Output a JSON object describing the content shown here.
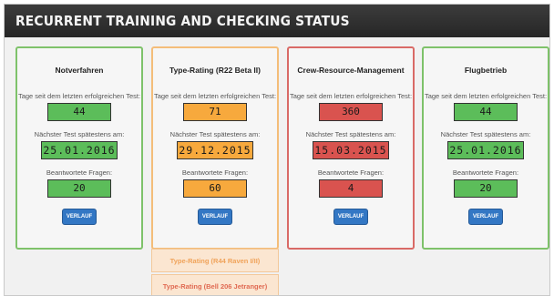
{
  "page": {
    "title": "RECURRENT TRAINING AND CHECKING STATUS"
  },
  "labels": {
    "days_since": "Tage seit dem letzten erfolgreichen Test:",
    "next_test": "Nächster Test spätestens am:",
    "answered": "Beantwortete Fragen:",
    "history_button": "VERLAUF"
  },
  "cards": [
    {
      "title": "Notverfahren",
      "status": "green",
      "days": "44",
      "next_date": "25.01.2016",
      "questions": "20"
    },
    {
      "title": "Type-Rating (R22 Beta II)",
      "status": "orange",
      "days": "71",
      "next_date": "29.12.2015",
      "questions": "60"
    },
    {
      "title": "Crew-Resource-Management",
      "status": "red",
      "days": "360",
      "next_date": "15.03.2015",
      "questions": "4"
    },
    {
      "title": "Flugbetrieb",
      "status": "green",
      "days": "44",
      "next_date": "25.01.2016",
      "questions": "20"
    }
  ],
  "dropdown_items": [
    {
      "label": "Type-Rating (R44 Raven I/II)"
    },
    {
      "label": "Type-Rating (Bell 206 Jetranger)"
    }
  ],
  "colors": {
    "green": "#5cbd5a",
    "orange": "#f7a93d",
    "red": "#d9534f",
    "button": "#3377c4",
    "header": "#2d2d2d"
  }
}
